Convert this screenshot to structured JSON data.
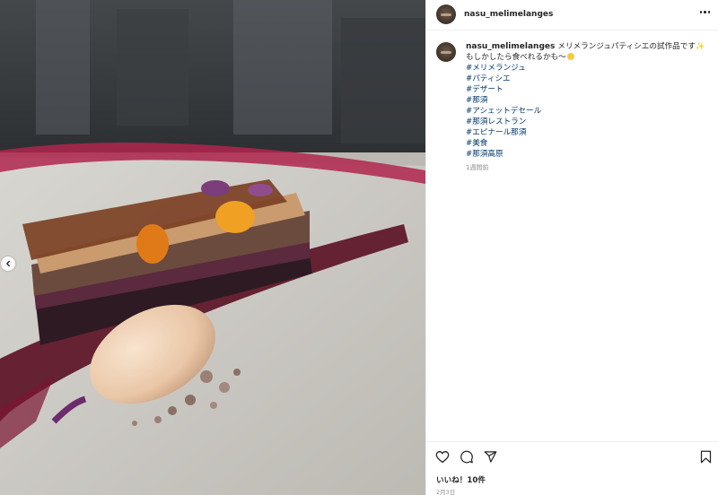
{
  "post": {
    "username": "nasu_melimelanges",
    "caption_text": "メリメランジュパティシエの試作品です",
    "caption_line2": "もしかしたら食べれるかも〜",
    "hashtags": [
      "#メリメランジュ",
      "#パティシエ",
      "#デザート",
      "#那須",
      "#アシェットデセール",
      "#那須レストラン",
      "#エピナール那須",
      "#美食",
      "#那須高原"
    ],
    "time_ago": "1週間前",
    "likes": "いいね！10件",
    "date": "2月3日"
  },
  "icons": {
    "more": "more-dots-icon",
    "prev": "chevron-left-icon",
    "like": "heart-icon",
    "comment": "comment-icon",
    "share": "send-icon",
    "save": "bookmark-icon"
  }
}
